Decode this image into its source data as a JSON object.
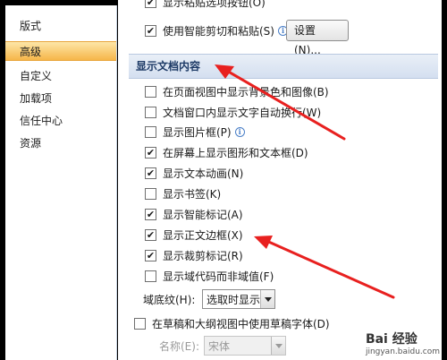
{
  "nav": {
    "items": [
      {
        "label": "版式",
        "active": false
      },
      {
        "label": "高级",
        "active": true
      },
      {
        "label": "自定义",
        "active": false
      },
      {
        "label": "加载项",
        "active": false
      },
      {
        "label": "信任中心",
        "active": false
      },
      {
        "label": "资源",
        "active": false
      }
    ]
  },
  "top": {
    "partial_label": "显示粘贴选项按钮(O)",
    "smart_cut_label": "使用智能剪切和粘贴(S)",
    "smart_cut_checked": true,
    "settings_button": "设置(N)..."
  },
  "section": {
    "title": "显示文档内容"
  },
  "options": [
    {
      "label": "在页面视图中显示背景色和图像(B)",
      "checked": false
    },
    {
      "label": "文档窗口内显示文字自动换行(W)",
      "checked": false
    },
    {
      "label": "显示图片框(P)",
      "checked": false,
      "info": true
    },
    {
      "label": "在屏幕上显示图形和文本框(D)",
      "checked": true
    },
    {
      "label": "显示文本动画(N)",
      "checked": true
    },
    {
      "label": "显示书签(K)",
      "checked": false
    },
    {
      "label": "显示智能标记(A)",
      "checked": true
    },
    {
      "label": "显示正文边框(X)",
      "checked": true
    },
    {
      "label": "显示裁剪标记(R)",
      "checked": true
    },
    {
      "label": "显示域代码而非域值(F)",
      "checked": false
    }
  ],
  "field_shading": {
    "label": "域底纹(H):",
    "value": "选取时显示"
  },
  "draft_font": {
    "label": "在草稿和大纲视图中使用草稿字体(D)",
    "checked": false
  },
  "font_name": {
    "label": "名称(E):",
    "value": "宋体"
  },
  "watermark": {
    "text": "Bai 经验",
    "sub": "jingyan.baidu.com"
  },
  "colors": {
    "arrow": "#e8201f",
    "accent": "#f6b64a"
  }
}
